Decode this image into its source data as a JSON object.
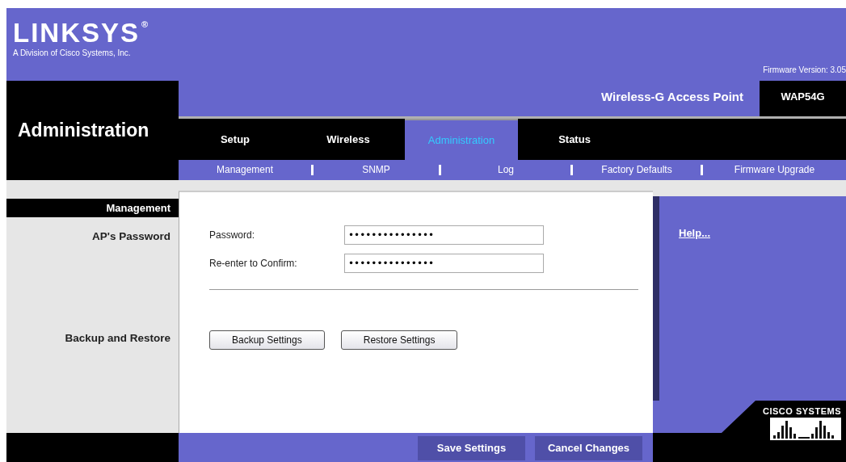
{
  "brand": {
    "logo": "LINKSYS",
    "logo_mark": "®",
    "tagline": "A Division of Cisco Systems, Inc.",
    "firmware": "Firmware Version: 3.05"
  },
  "product": {
    "name": "Wireless-G Access Point",
    "model": "WAP54G"
  },
  "section_title": "Administration",
  "tabs": [
    {
      "label": "Setup",
      "selected": false
    },
    {
      "label": "Wireless",
      "selected": false
    },
    {
      "label": "Administration",
      "selected": true
    },
    {
      "label": "Status",
      "selected": false
    }
  ],
  "subtabs": [
    "Management",
    "SNMP",
    "Log",
    "Factory Defaults",
    "Firmware Upgrade"
  ],
  "sidebar_header": "Management",
  "sections": [
    {
      "label": "AP's Password",
      "kind": "fields",
      "fields": [
        {
          "label": "Password:",
          "value": "•••••••••••••••"
        },
        {
          "label": "Re-enter to Confirm:",
          "value": "•••••••••••••••"
        }
      ]
    },
    {
      "label": "Backup and Restore",
      "kind": "buttons",
      "buttons": [
        "Backup Settings",
        "Restore Settings"
      ]
    }
  ],
  "help_link": "Help...",
  "footer_buttons": [
    "Save Settings",
    "Cancel Changes"
  ],
  "vendor_logo": "CISCO SYSTEMS"
}
